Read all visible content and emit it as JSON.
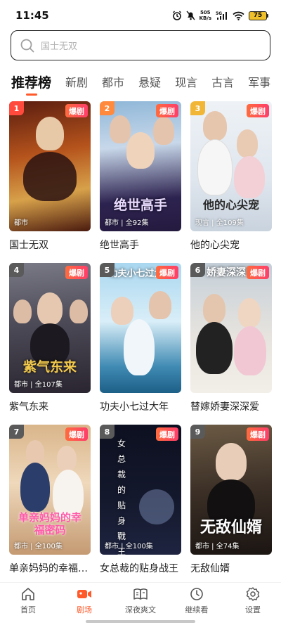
{
  "status_bar": {
    "time": "11:45",
    "net_speed_value": "505",
    "net_speed_unit": "KB/s",
    "signal_label": "5G",
    "battery": "75"
  },
  "search": {
    "placeholder": "国士无双"
  },
  "tabs": [
    {
      "label": "推荐榜",
      "active": true
    },
    {
      "label": "新剧"
    },
    {
      "label": "都市"
    },
    {
      "label": "悬疑"
    },
    {
      "label": "现言"
    },
    {
      "label": "古言"
    },
    {
      "label": "军事"
    }
  ],
  "colors": {
    "accent": "#ff5a2a",
    "rank_1": "#ff4a3d",
    "rank_2": "#ff8a3d",
    "rank_3": "#f2b636",
    "rank_other": "#5a5a5a"
  },
  "cards": [
    {
      "rank": "1",
      "badge": "爆剧",
      "meta": "都市",
      "title": "国士无双",
      "poster_text": ""
    },
    {
      "rank": "2",
      "badge": "爆剧",
      "meta": "都市 | 全92集",
      "title": "绝世高手",
      "poster_text": "绝世高手"
    },
    {
      "rank": "3",
      "badge": "爆剧",
      "meta": "现言 | 全109集",
      "title": "他的心尖宠",
      "poster_text": "他的心尖宠"
    },
    {
      "rank": "4",
      "badge": "爆剧",
      "meta": "都市 | 全107集",
      "title": "紫气东来",
      "poster_text": "紫气东来"
    },
    {
      "rank": "5",
      "badge": "爆剧",
      "meta": "",
      "title": "功夫小七过大年",
      "poster_text": "功夫小七过大年"
    },
    {
      "rank": "6",
      "badge": "爆剧",
      "meta": "",
      "title": "替嫁娇妻深深爱",
      "poster_text": "娇妻深深爱"
    },
    {
      "rank": "7",
      "badge": "爆剧",
      "meta": "都市 | 全100集",
      "title": "单亲妈妈的幸福密码",
      "poster_text": "单亲妈妈的幸福密码"
    },
    {
      "rank": "8",
      "badge": "爆剧",
      "meta": "都市 | 全100集",
      "title": "女总裁的贴身战王",
      "poster_text": "女总裁的贴身戰王"
    },
    {
      "rank": "9",
      "badge": "爆剧",
      "meta": "都市 | 全74集",
      "title": "无敌仙婿",
      "poster_text": "无敌仙婿"
    }
  ],
  "bottom_nav": [
    {
      "label": "首页",
      "icon": "home-icon"
    },
    {
      "label": "剧场",
      "icon": "theater-icon",
      "active": true
    },
    {
      "label": "深夜爽文",
      "icon": "book-icon"
    },
    {
      "label": "继续看",
      "icon": "clock-icon"
    },
    {
      "label": "设置",
      "icon": "gear-icon"
    }
  ]
}
